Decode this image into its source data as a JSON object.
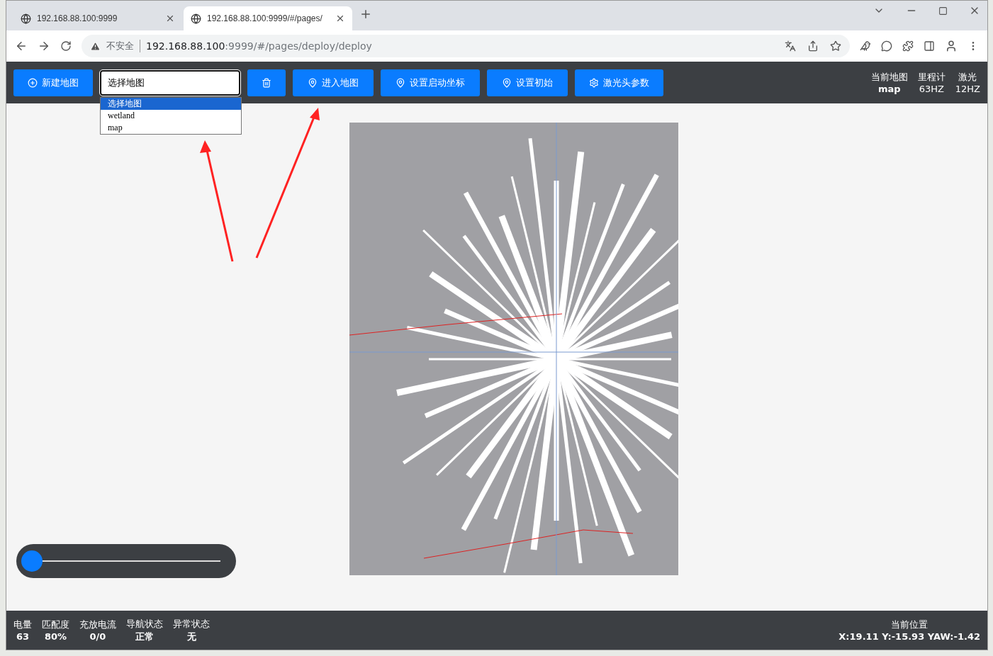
{
  "browser": {
    "tabs": [
      {
        "title": "192.168.88.100:9999",
        "selected": false
      },
      {
        "title": "192.168.88.100:9999/#/pages/",
        "selected": true
      }
    ],
    "security": "不安全",
    "url_host": "192.168.88.100",
    "url_rest": ":9999/#/pages/deploy/deploy"
  },
  "toolbar": {
    "buttons": [
      {
        "kind": "plus",
        "label": "新建地图"
      },
      {
        "kind": "select"
      },
      {
        "kind": "trash"
      },
      {
        "kind": "pin",
        "label": "进入地图"
      },
      {
        "kind": "pin",
        "label": "设置启动坐标"
      },
      {
        "kind": "pin",
        "label": "设置初始"
      },
      {
        "kind": "gear",
        "label": "激光头参数"
      }
    ],
    "select": {
      "value": "选择地图",
      "options": [
        {
          "label": "选择地图",
          "selected": true
        },
        {
          "label": "wetland",
          "selected": false
        },
        {
          "label": "map",
          "selected": false
        }
      ]
    },
    "stats": [
      {
        "label": "当前地图",
        "value": "map",
        "bold": true
      },
      {
        "label": "里程计",
        "value": "63HZ",
        "bold": false
      },
      {
        "label": "激光",
        "value": "12HZ",
        "bold": false
      }
    ]
  },
  "slider": {
    "level": 0
  },
  "status_bar": {
    "items": [
      {
        "label": "电量",
        "value": "63"
      },
      {
        "label": "匹配度",
        "value": "80%"
      },
      {
        "label": "充放电流",
        "value": "0/0"
      },
      {
        "label": "导航状态",
        "value": "正常"
      },
      {
        "label": "异常状态",
        "value": "无"
      }
    ],
    "position": {
      "label": "当前位置",
      "value": "X:19.11 Y:-15.93 YAW:-1.42"
    }
  }
}
